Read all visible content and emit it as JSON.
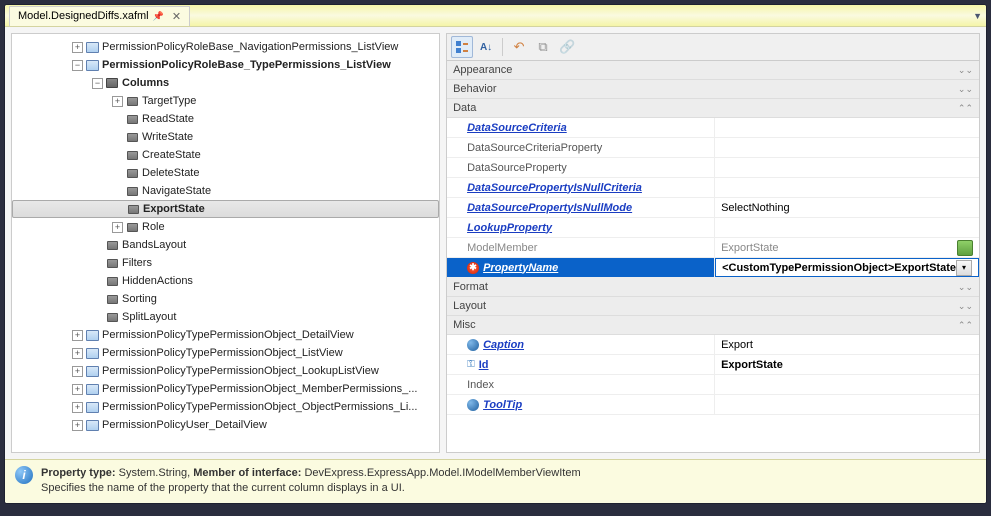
{
  "tab": {
    "title": "Model.DesignedDiffs.xafml"
  },
  "tree": {
    "items": [
      {
        "label": "PermissionPolicyRoleBase_NavigationPermissions_ListView",
        "indent": 60,
        "exp": "+",
        "icon": "list",
        "bold": false
      },
      {
        "label": "PermissionPolicyRoleBase_TypePermissions_ListView",
        "indent": 60,
        "exp": "−",
        "icon": "list",
        "bold": true
      },
      {
        "label": "Columns",
        "indent": 80,
        "exp": "−",
        "icon": "folder",
        "bold": true
      },
      {
        "label": "TargetType",
        "indent": 100,
        "exp": "+",
        "icon": "item",
        "bold": false
      },
      {
        "label": "ReadState",
        "indent": 100,
        "exp": "",
        "icon": "item",
        "bold": false
      },
      {
        "label": "WriteState",
        "indent": 100,
        "exp": "",
        "icon": "item",
        "bold": false
      },
      {
        "label": "CreateState",
        "indent": 100,
        "exp": "",
        "icon": "item",
        "bold": false
      },
      {
        "label": "DeleteState",
        "indent": 100,
        "exp": "",
        "icon": "item",
        "bold": false
      },
      {
        "label": "NavigateState",
        "indent": 100,
        "exp": "",
        "icon": "item",
        "bold": false
      },
      {
        "label": "ExportState",
        "indent": 100,
        "exp": "",
        "icon": "item",
        "bold": true,
        "selected": true
      },
      {
        "label": "Role",
        "indent": 100,
        "exp": "+",
        "icon": "item",
        "bold": false
      },
      {
        "label": "BandsLayout",
        "indent": 80,
        "exp": "",
        "icon": "item",
        "bold": false
      },
      {
        "label": "Filters",
        "indent": 80,
        "exp": "",
        "icon": "item",
        "bold": false
      },
      {
        "label": "HiddenActions",
        "indent": 80,
        "exp": "",
        "icon": "item",
        "bold": false
      },
      {
        "label": "Sorting",
        "indent": 80,
        "exp": "",
        "icon": "item",
        "bold": false
      },
      {
        "label": "SplitLayout",
        "indent": 80,
        "exp": "",
        "icon": "item",
        "bold": false
      },
      {
        "label": "PermissionPolicyTypePermissionObject_DetailView",
        "indent": 60,
        "exp": "+",
        "icon": "list",
        "bold": false
      },
      {
        "label": "PermissionPolicyTypePermissionObject_ListView",
        "indent": 60,
        "exp": "+",
        "icon": "list",
        "bold": false
      },
      {
        "label": "PermissionPolicyTypePermissionObject_LookupListView",
        "indent": 60,
        "exp": "+",
        "icon": "list",
        "bold": false
      },
      {
        "label": "PermissionPolicyTypePermissionObject_MemberPermissions_...",
        "indent": 60,
        "exp": "+",
        "icon": "list",
        "bold": false
      },
      {
        "label": "PermissionPolicyTypePermissionObject_ObjectPermissions_Li...",
        "indent": 60,
        "exp": "+",
        "icon": "list",
        "bold": false
      },
      {
        "label": "PermissionPolicyUser_DetailView",
        "indent": 60,
        "exp": "+",
        "icon": "list",
        "bold": false
      }
    ]
  },
  "categories": {
    "appearance": "Appearance",
    "behavior": "Behavior",
    "data": "Data",
    "format": "Format",
    "layout": "Layout",
    "misc": "Misc"
  },
  "props": {
    "data": [
      {
        "name": "DataSourceCriteria",
        "val": "",
        "style": "link"
      },
      {
        "name": "DataSourceCriteriaProperty",
        "val": "",
        "style": "plain"
      },
      {
        "name": "DataSourceProperty",
        "val": "",
        "style": "plain"
      },
      {
        "name": "DataSourcePropertyIsNullCriteria",
        "val": "",
        "style": "link"
      },
      {
        "name": "DataSourcePropertyIsNullMode",
        "val": "SelectNothing",
        "style": "link"
      },
      {
        "name": "LookupProperty",
        "val": "",
        "style": "link"
      },
      {
        "name": "ModelMember",
        "val": "ExportState",
        "style": "readonly",
        "action": true
      },
      {
        "name": "PropertyName",
        "val": "<CustomTypePermissionObject>ExportState",
        "style": "selected-required"
      }
    ],
    "misc": [
      {
        "name": "Caption",
        "val": "Export",
        "style": "link-globe"
      },
      {
        "name": "Id",
        "val": "ExportState",
        "style": "key-bold"
      },
      {
        "name": "Index",
        "val": "",
        "style": "plain"
      },
      {
        "name": "ToolTip",
        "val": "",
        "style": "link-globe"
      }
    ]
  },
  "footer": {
    "line1_a": "Property type:",
    "line1_b": " System.String, ",
    "line1_c": "Member of interface:",
    "line1_d": " DevExpress.ExpressApp.Model.IModelMemberViewItem",
    "line2": "Specifies the name of the property that the current column displays in a UI."
  }
}
